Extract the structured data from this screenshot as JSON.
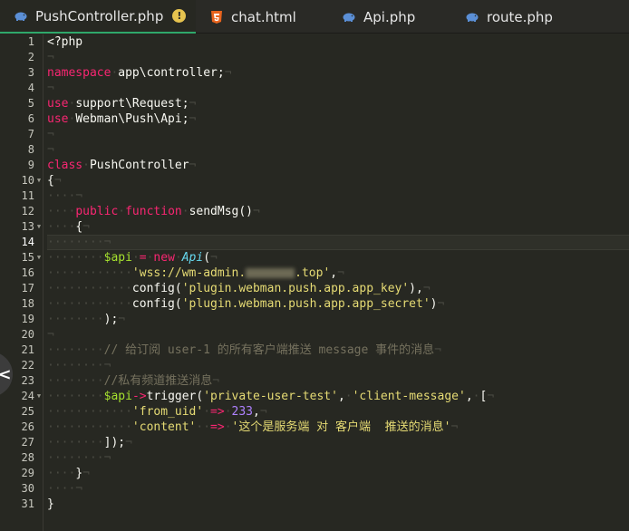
{
  "tabs": [
    {
      "label": "PushController.php",
      "icon": "php-elephant-icon",
      "active": true,
      "warning": "!"
    },
    {
      "label": "chat.html",
      "icon": "html5-icon",
      "active": false
    },
    {
      "label": "Api.php",
      "icon": "php-elephant-icon",
      "active": false
    },
    {
      "label": "route.php",
      "icon": "php-elephant-icon",
      "active": false
    }
  ],
  "colors": {
    "background": "#272822",
    "keyword": "#f92672",
    "variable": "#a6e22e",
    "class": "#66d9ef",
    "string": "#e6db74",
    "number": "#ae81ff",
    "comment": "#75715e",
    "active_tab_underline": "#2fa86b",
    "warning": "#e6c34f",
    "html_icon": "#e8641e",
    "php_icon": "#5b8fd6"
  },
  "editor": {
    "current_line": 14,
    "folds": [
      10,
      13,
      15,
      24
    ],
    "line_numbers": [
      "1",
      "2",
      "3",
      "4",
      "5",
      "6",
      "7",
      "8",
      "9",
      "10",
      "11",
      "12",
      "13",
      "14",
      "15",
      "16",
      "17",
      "18",
      "19",
      "20",
      "21",
      "22",
      "23",
      "24",
      "25",
      "26",
      "27",
      "28",
      "29",
      "30",
      "31"
    ],
    "code": {
      "l1_open": "<?php",
      "l3_kw": "namespace",
      "l3_ns": "app\\controller;",
      "l5_kw": "use",
      "l5_cls": "support\\Request;",
      "l6_kw": "use",
      "l6_cls": "Webman\\Push\\Api;",
      "l9_kw": "class",
      "l9_name": "PushController",
      "l10": "{",
      "l12_kw1": "public",
      "l12_kw2": "function",
      "l12_fn": "sendMsg()",
      "l13": "{",
      "l15_var": "$api",
      "l15_op": "=",
      "l15_new": "new",
      "l15_cls": "Api",
      "l15_paren": "(",
      "l16_str_a": "'wss://wm-admin.",
      "l16_str_b": ".top'",
      "l16_comma": ",",
      "l17_fn": "config(",
      "l17_str": "'plugin.webman.push.app.app_key'",
      "l17_end": "),",
      "l18_fn": "config(",
      "l18_str": "'plugin.webman.push.app.app_secret'",
      "l18_end": ")",
      "l19": ");",
      "l21_cmt": "// 给订阅 user-1 的所有客户端推送 message 事件的消息",
      "l23_cmt": "//私有频道推送消息",
      "l24_var": "$api",
      "l24_arrow": "->",
      "l24_fn": "trigger(",
      "l24_str1": "'private-user-test'",
      "l24_comma1": ",",
      "l24_str2": "'client-message'",
      "l24_comma2": ",",
      "l24_bracket": "[",
      "l25_key": "'from_uid'",
      "l25_op": "=>",
      "l25_num": "233",
      "l25_comma": ",",
      "l26_key": "'content'",
      "l26_op": "=>",
      "l26_str": "'这个是服务端 对 客户端  推送的消息'",
      "l27": "]);",
      "l29": "}",
      "l31": "}"
    }
  },
  "side_toggle": {
    "glyph": "<",
    "icon": "chevron-left-icon"
  }
}
